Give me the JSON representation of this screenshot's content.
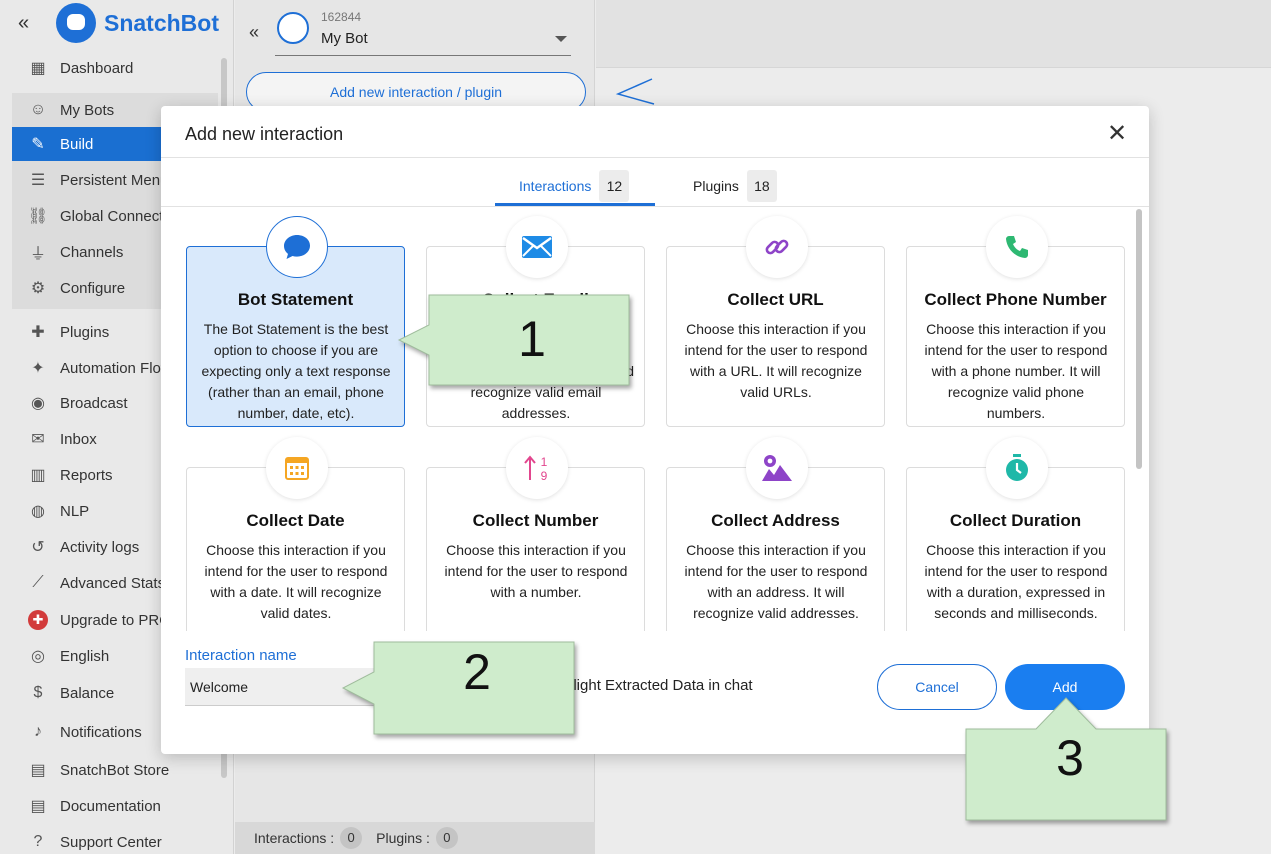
{
  "sidebar": {
    "brand": "SnatchBot",
    "collapse_icon": "double-chevron-left-icon",
    "items": [
      {
        "label": "Dashboard",
        "icon": "dashboard-icon"
      },
      {
        "label": "My Bots",
        "icon": "robot-icon"
      },
      {
        "label": "Build",
        "icon": "edit-icon"
      },
      {
        "label": "Persistent Menu",
        "icon": "menu-icon"
      },
      {
        "label": "Global Connections",
        "icon": "link-icon"
      },
      {
        "label": "Channels",
        "icon": "plug-icon"
      },
      {
        "label": "Configure",
        "icon": "gear-icon"
      },
      {
        "label": "Plugins",
        "icon": "puzzle-icon"
      },
      {
        "label": "Automation Flows",
        "icon": "magic-wand-icon"
      },
      {
        "label": "Broadcast",
        "icon": "broadcast-icon"
      },
      {
        "label": "Inbox",
        "icon": "chat-icon"
      },
      {
        "label": "Reports",
        "icon": "bar-chart-icon"
      },
      {
        "label": "NLP",
        "icon": "nlp-icon"
      },
      {
        "label": "Activity logs",
        "icon": "history-icon"
      },
      {
        "label": "Advanced Stats",
        "icon": "line-chart-icon"
      },
      {
        "label": "Upgrade to PRO",
        "icon": "upgrade-icon"
      },
      {
        "label": "English",
        "icon": "globe-icon"
      },
      {
        "label": "Balance",
        "icon": "dollar-icon"
      },
      {
        "label": "Notifications",
        "icon": "bell-icon"
      },
      {
        "label": "SnatchBot Store",
        "icon": "store-icon"
      },
      {
        "label": "Documentation",
        "icon": "document-icon"
      },
      {
        "label": "Support Center",
        "icon": "help-icon"
      }
    ]
  },
  "middle": {
    "bot_id": "162844",
    "bot_name": "My Bot",
    "add_button": "Add new interaction / plugin",
    "footer": {
      "interactions_label": "Interactions :",
      "interactions_count": "0",
      "plugins_label": "Plugins :",
      "plugins_count": "0"
    }
  },
  "modal": {
    "title": "Add new interaction",
    "tabs": [
      {
        "label": "Interactions",
        "count": "12"
      },
      {
        "label": "Plugins",
        "count": "18"
      }
    ],
    "cards": [
      {
        "title": "Bot Statement",
        "icon": "speech-bubble-icon",
        "color": "#1e6fd6",
        "desc": "The Bot Statement is the best option to choose if you are expecting only a text response (rather than an email, phone number, date, etc)."
      },
      {
        "title": "Collect Email",
        "icon": "envelope-icon",
        "color": "#1e8be6",
        "desc": "Choose this interaction if you intend for the user to respond with an email. It will identify and recognize valid email addresses."
      },
      {
        "title": "Collect URL",
        "icon": "link-icon",
        "color": "#8e44c8",
        "desc": "Choose this interaction if you intend for the user to respond with a URL. It will recognize valid URLs."
      },
      {
        "title": "Collect Phone Number",
        "icon": "phone-icon",
        "color": "#2eb872",
        "desc": "Choose this interaction if you intend for the user to respond with a phone number. It will recognize valid phone numbers."
      },
      {
        "title": "Collect Date",
        "icon": "calendar-icon",
        "color": "#f5a623",
        "desc": "Choose this interaction if you intend for the user to respond with a date. It will recognize valid dates."
      },
      {
        "title": "Collect Number",
        "icon": "numbers-icon",
        "color": "#e2468e",
        "desc": "Choose this interaction if you intend for the user to respond with a number."
      },
      {
        "title": "Collect Address",
        "icon": "map-icon",
        "color": "#8e44c8",
        "desc": "Choose this interaction if you intend for the user to respond with an address. It will recognize valid addresses."
      },
      {
        "title": "Collect Duration",
        "icon": "stopwatch-icon",
        "color": "#1fb8a8",
        "desc": "Choose this interaction if you intend for the user to respond with a duration, expressed in seconds and milliseconds."
      }
    ],
    "name_label": "Interaction name",
    "name_value": "Welcome",
    "highlight_label": "Highlight Extracted Data in chat",
    "highlight_visible": "hlight Extracted Data in chat",
    "cancel": "Cancel",
    "add": "Add"
  },
  "callouts": [
    "1",
    "2",
    "3"
  ]
}
